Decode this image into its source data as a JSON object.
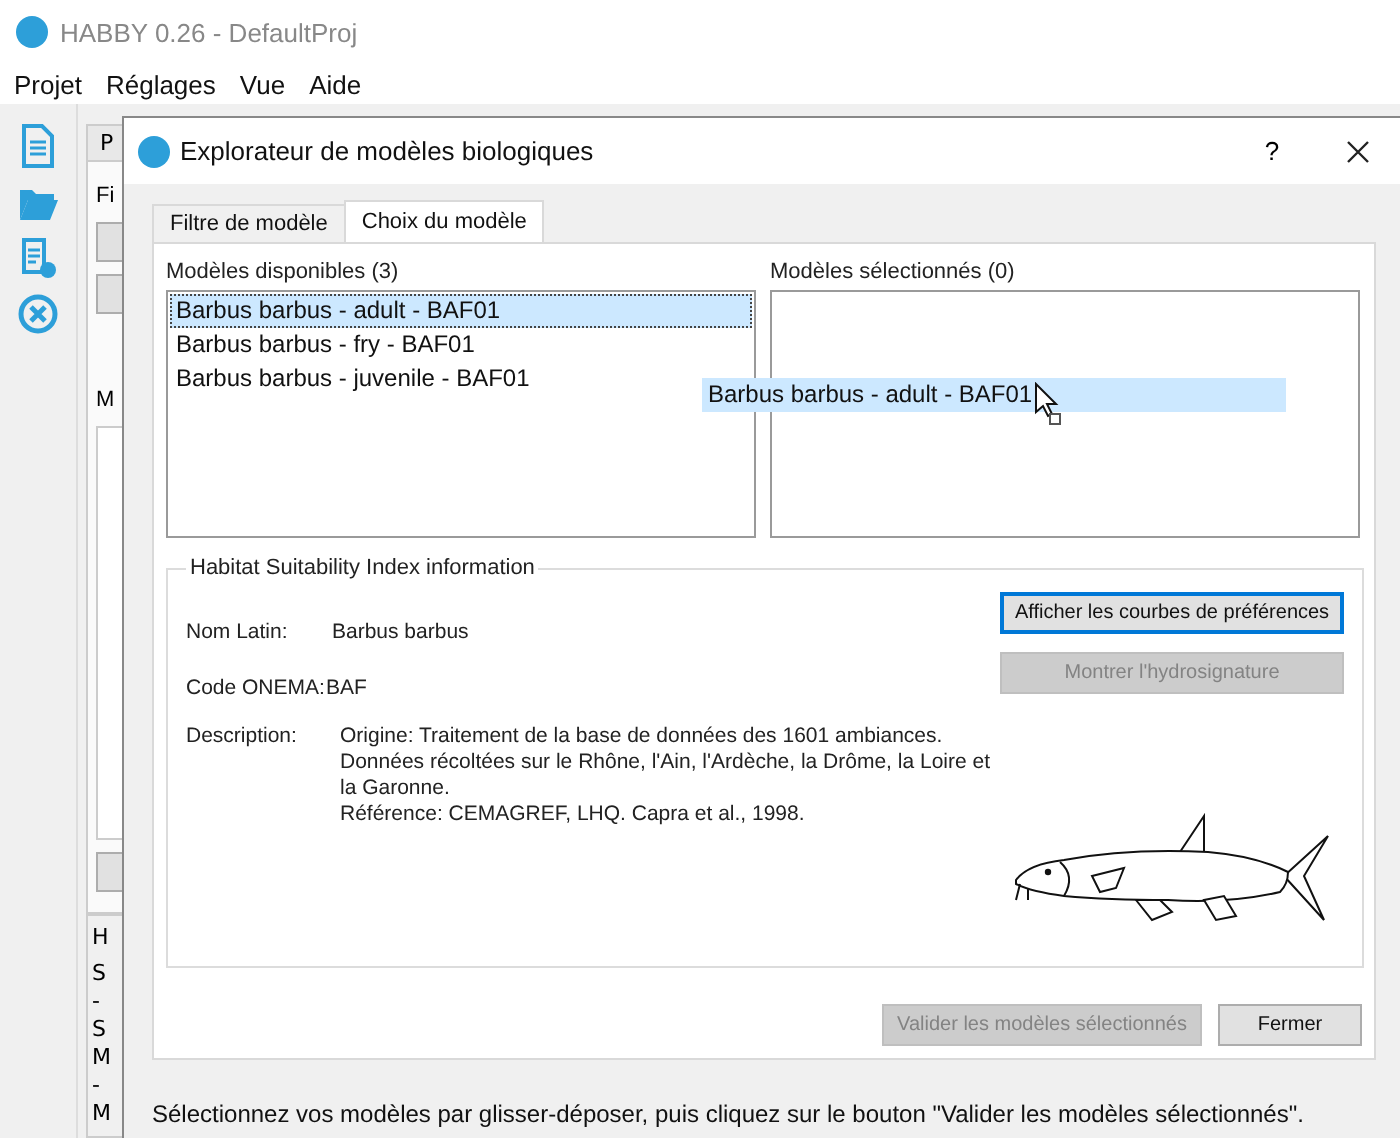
{
  "app_window": {
    "title": "HABBY 0.26 - DefaultProj",
    "menu": [
      "Projet",
      "Réglages",
      "Vue",
      "Aide"
    ],
    "background": {
      "tab": "P",
      "label_top": "Fi",
      "label_mid": "M",
      "group_title": "H",
      "log_lines": [
        "S",
        "-",
        "S",
        "M",
        "-",
        "M"
      ]
    }
  },
  "dialog": {
    "title": "Explorateur de modèles biologiques",
    "help": "?",
    "tabs": [
      {
        "label": "Filtre de modèle",
        "selected": false
      },
      {
        "label": "Choix du modèle",
        "selected": true
      }
    ],
    "available": {
      "label": "Modèles disponibles (3)",
      "items": [
        {
          "label": "Barbus barbus - adult - BAF01",
          "selected": true
        },
        {
          "label": "Barbus barbus - fry - BAF01",
          "selected": false
        },
        {
          "label": "Barbus barbus - juvenile - BAF01",
          "selected": false
        }
      ]
    },
    "chosen": {
      "label": "Modèles sélectionnés (0)"
    },
    "drag_item": "Barbus barbus - adult - BAF01",
    "info": {
      "title": "Habitat Suitability Index information",
      "fields": [
        {
          "label": "Nom Latin:",
          "value": "Barbus barbus"
        },
        {
          "label": "Code ONEMA:",
          "value": "BAF"
        }
      ],
      "description_label": "Description:",
      "description": [
        "Origine: Traitement de la base de données des 1601 ambiances.",
        "Données récoltées sur le Rhône, l'Ain, l'Ardèche, la Drôme, la Loire et la Garonne.",
        "Référence: CEMAGREF, LHQ. Capra et al., 1998."
      ],
      "buttons": [
        {
          "label": "Afficher les courbes de préférences",
          "disabled": false,
          "focused": true
        },
        {
          "label": "Montrer l'hydrosignature",
          "disabled": true,
          "focused": false
        }
      ]
    },
    "actions": [
      {
        "label": "Valider les modèles sélectionnés",
        "disabled": true
      },
      {
        "label": "Fermer",
        "disabled": false
      }
    ],
    "status": "Sélectionnez vos modèles par glisser-déposer, puis cliquez sur le bouton \"Valider les modèles sélectionnés\"."
  }
}
